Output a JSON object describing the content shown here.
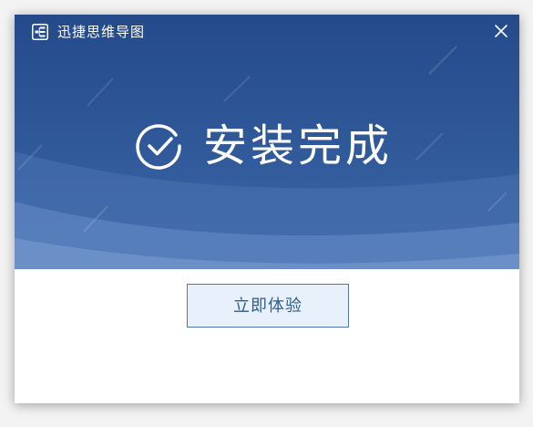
{
  "window": {
    "title": "迅捷思维导图",
    "app_icon": "mindmap-app-icon",
    "close_icon": "close-icon"
  },
  "hero": {
    "status_icon": "check-circle-icon",
    "status_text": "安装完成"
  },
  "actions": {
    "primary_label": "立即体验"
  },
  "colors": {
    "hero_top": "#244a8a",
    "hero_bottom": "#4a74b0",
    "button_bg": "#e7f0fb",
    "button_border": "#4f7aa8",
    "button_text": "#2f5d8c"
  }
}
